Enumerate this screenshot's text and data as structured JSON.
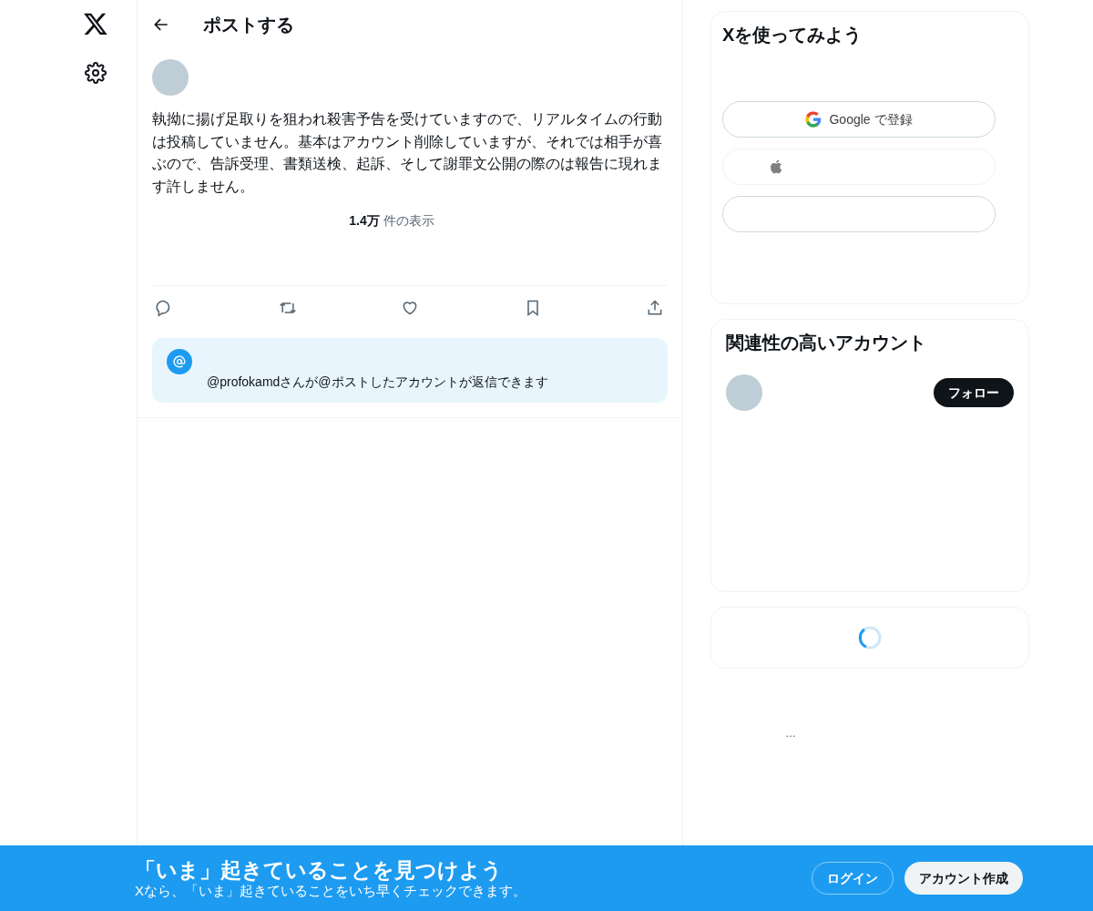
{
  "header": {
    "title": "ポストする"
  },
  "post": {
    "text": "執拗に揚げ足取りを狙われ殺害予告を受けていますので、リアルタイムの行動は投稿していません。基本はアカウント削除していますが、それでは相手が喜ぶので、告訴受理、書類送検、起訴、そして謝罪文公開の際のは報告に現れます許しません。",
    "views_count": "1.4万",
    "views_label": "件の表示",
    "reply_notice": "@profokamdさんが@ポストしたアカウントが返信できます"
  },
  "signup_card": {
    "title": "Xを使ってみよう",
    "google_button": "Google で登録"
  },
  "related_card": {
    "title": "関連性の高いアカウント",
    "follow_button": "フォロー"
  },
  "footer_more": "…",
  "banner": {
    "title": "「いま」起きていることを見つけよう",
    "subtitle": "Xなら、「いま」起きていることをいち早くチェックできます。",
    "login": "ログイン",
    "signup": "アカウント作成"
  }
}
